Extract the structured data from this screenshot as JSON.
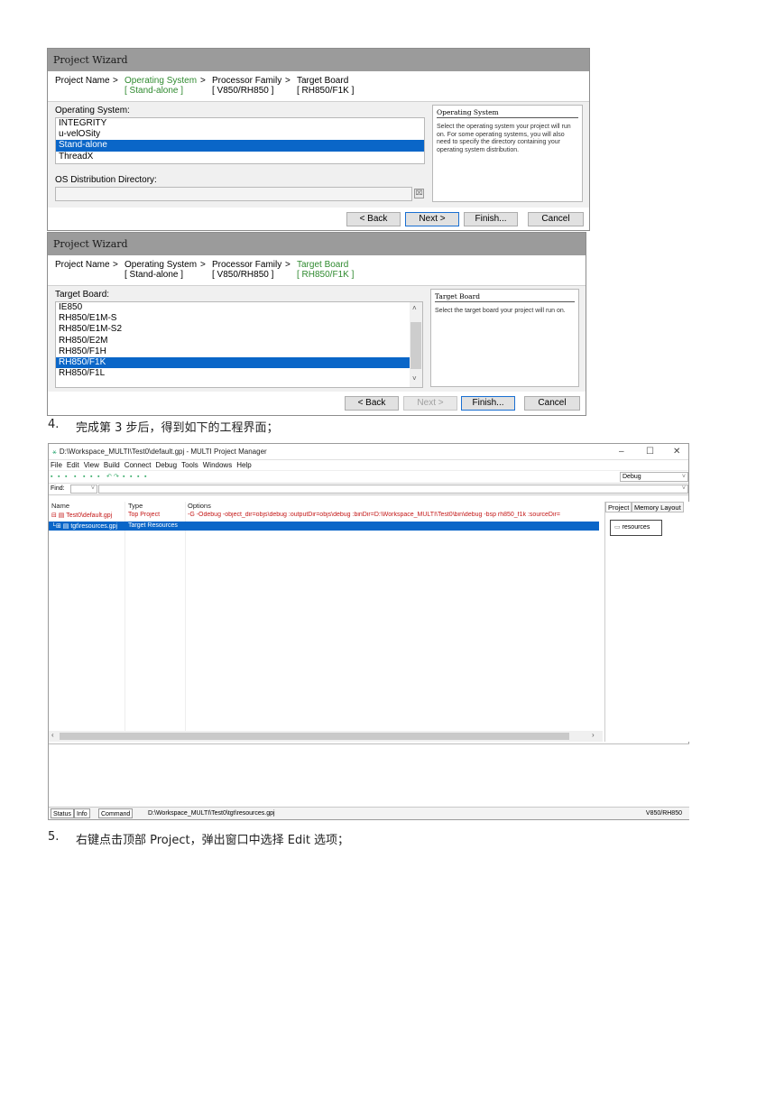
{
  "wizard1": {
    "title": "Project Wizard",
    "crumbs": {
      "project_name": "Project Name",
      "sep1": ">",
      "operating_system": "Operating System",
      "sep2": ">",
      "processor_family": "Processor Family",
      "sep3": ">",
      "target_board": "Target Board",
      "os_value": "[ Stand-alone ]",
      "pf_value": "[ V850/RH850 ]",
      "tb_value": "[ RH850/F1K ]"
    },
    "list_label": "Operating System:",
    "items": [
      "INTEGRITY",
      "u-velOSity",
      "Stand-alone",
      "ThreadX"
    ],
    "selected_index": 2,
    "dir_label": "OS Distribution Directory:",
    "dir_value": "",
    "help_title": "Operating System",
    "help_text": "Select the operating system your project will run on.  For some operating systems, you will also need to specify the directory containing your operating system distribution.",
    "buttons": {
      "back": "< Back",
      "next": "Next >",
      "finish": "Finish...",
      "cancel": "Cancel"
    }
  },
  "wizard2": {
    "title": "Project Wizard",
    "crumbs": {
      "project_name": "Project Name",
      "sep1": ">",
      "operating_system": "Operating System",
      "sep2": ">",
      "processor_family": "Processor Family",
      "sep3": ">",
      "target_board": "Target Board",
      "os_value": "[ Stand-alone ]",
      "pf_value": "[ V850/RH850 ]",
      "tb_value": "[ RH850/F1K ]"
    },
    "list_label": "Target Board:",
    "items": [
      "IE850",
      "RH850/E1M-S",
      "RH850/E1M-S2",
      "RH850/E2M",
      "RH850/F1H",
      "RH850/F1K",
      "RH850/F1L"
    ],
    "selected_index": 5,
    "help_title": "Target Board",
    "help_text": "Select the target board your project will run on.",
    "buttons": {
      "back": "< Back",
      "next": "Next >",
      "finish": "Finish...",
      "cancel": "Cancel"
    }
  },
  "captions": {
    "step4_num": "4.",
    "step4_text": "完成第 3 步后，得到如下的工程界面；",
    "step5_num": "5.",
    "step5_text": "右键点击顶部 Project，弹出窗口中选择 Edit 选项；"
  },
  "pm": {
    "title": "D:\\Workspace_MULTI\\Test0\\default.gpj - MULTI Project Manager",
    "window_controls": {
      "minimize": "–",
      "maximize": "☐",
      "close": "✕"
    },
    "menu": [
      "File",
      "Edit",
      "View",
      "Build",
      "Connect",
      "Debug",
      "Tools",
      "Windows",
      "Help"
    ],
    "build_config": "Debug",
    "find_label": "Find:",
    "columns": {
      "name": "Name",
      "type": "Type",
      "options": "Options"
    },
    "rows": [
      {
        "name": "Test0\\default.gpj",
        "type": "Top Project",
        "options": "-G -Odebug -object_dir=objs\\debug :outputDir=objs\\debug :binDir=D:\\Workspace_MULTI\\Test0\\bin\\debug -bsp rh850_f1k :sourceDir="
      },
      {
        "name": "tgt\\resources.gpj",
        "type": "Target Resources",
        "options": ""
      }
    ],
    "right_tabs": [
      "Project",
      "Memory Layout"
    ],
    "resource_button": "resources",
    "status_tabs": [
      "Status",
      "Info",
      "Command"
    ],
    "status_path": "D:\\Workspace_MULTI\\Test0\\tgt\\resources.gpj",
    "status_target": "V850/RH850"
  }
}
